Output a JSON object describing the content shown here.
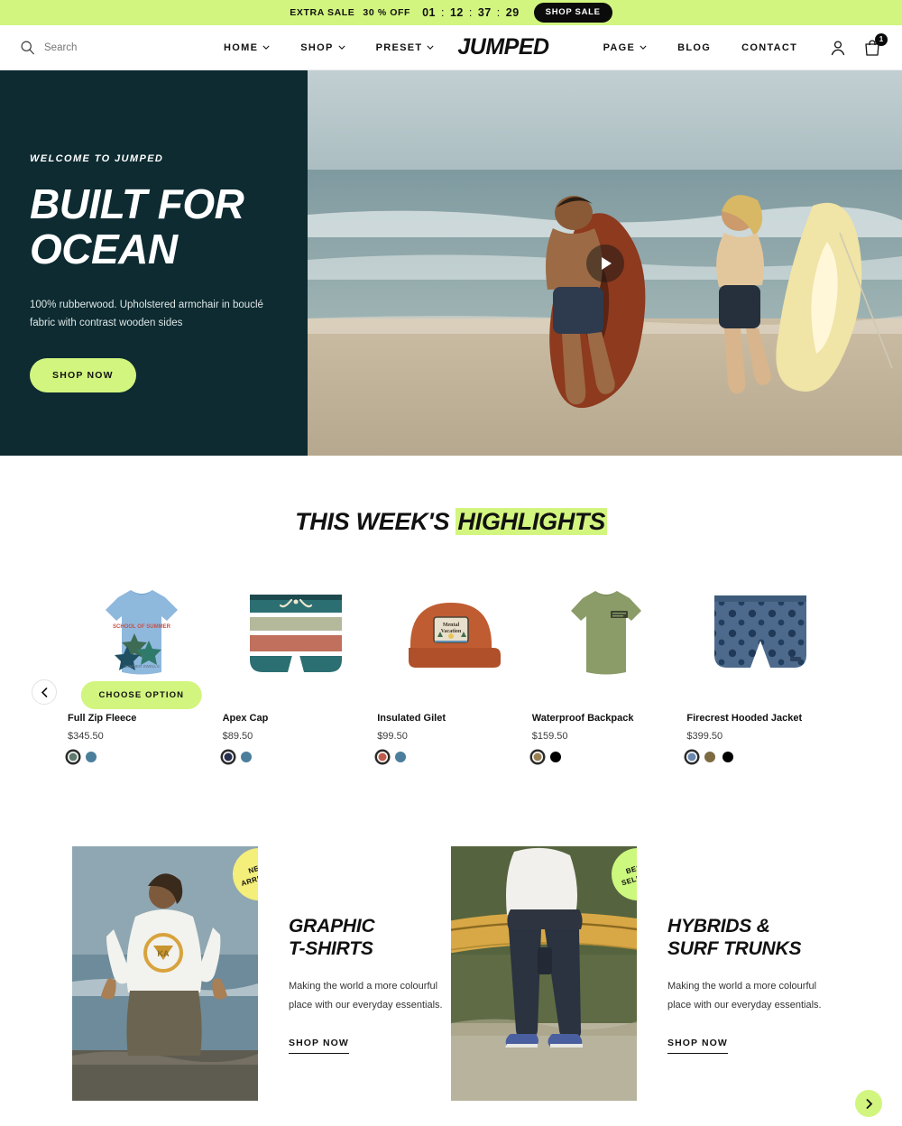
{
  "announcement": {
    "label": "EXTRA SALE",
    "discount": "30 % OFF",
    "countdown": {
      "days": "01",
      "hours": "12",
      "minutes": "37",
      "seconds": "29",
      "separator": ":"
    },
    "cta": "SHOP SALE",
    "bg_color": "#d2f57f"
  },
  "header": {
    "search_placeholder": "Search",
    "search_value": "",
    "logo": "JUMPED",
    "nav_left": [
      {
        "label": "HOME",
        "has_dropdown": true
      },
      {
        "label": "SHOP",
        "has_dropdown": true
      },
      {
        "label": "PRESET",
        "has_dropdown": true
      }
    ],
    "nav_right": [
      {
        "label": "PAGE",
        "has_dropdown": true
      },
      {
        "label": "BLOG",
        "has_dropdown": false
      },
      {
        "label": "CONTACT",
        "has_dropdown": false
      }
    ],
    "account_icon": "user-icon",
    "cart_icon": "cart-icon",
    "cart_count": "1"
  },
  "hero": {
    "eyebrow": "WELCOME TO JUMPED",
    "title_line1": "BUILT FOR",
    "title_line2": "OCEAN",
    "description": "100% rubberwood. Upholstered armchair in bouclé fabric with contrast wooden sides",
    "cta": "SHOP NOW",
    "bg_color": "#0d2b31",
    "accent_color": "#d2f57f",
    "media": "beach-surfers-video",
    "play_icon": "play-icon"
  },
  "highlights": {
    "title_plain": "THIS WEEK'S ",
    "title_highlight": "HIGHLIGHTS",
    "prev_label": "chevron-left-icon",
    "next_label": "chevron-right-icon",
    "hover_cta": "CHOOSE OPTION",
    "products": [
      {
        "name": "Full Zip Fleece",
        "price": "$345.50",
        "image": "light-blue-graphic-tshirt",
        "hovered": true,
        "swatches": [
          {
            "color": "#5f7b70",
            "selected": true
          },
          {
            "color": "#4a7e9b",
            "selected": false
          }
        ]
      },
      {
        "name": "Apex Cap",
        "price": "$89.50",
        "image": "striped-board-shorts",
        "hovered": false,
        "swatches": [
          {
            "color": "#28304f",
            "selected": true
          },
          {
            "color": "#4a7e9b",
            "selected": false
          }
        ]
      },
      {
        "name": "Insulated Gilet",
        "price": "$99.50",
        "image": "rust-mental-vacation-cap",
        "hovered": false,
        "swatches": [
          {
            "color": "#c05c4b",
            "selected": true
          },
          {
            "color": "#4a7e9b",
            "selected": false
          }
        ]
      },
      {
        "name": "Waterproof Backpack",
        "price": "$159.50",
        "image": "olive-green-tshirt",
        "hovered": false,
        "swatches": [
          {
            "color": "#9a8155",
            "selected": true
          },
          {
            "color": "#000000",
            "selected": false
          }
        ]
      },
      {
        "name": "Firecrest Hooded Jacket",
        "price": "$399.50",
        "image": "navy-floral-shorts",
        "hovered": false,
        "swatches": [
          {
            "color": "#6b88ae",
            "selected": true
          },
          {
            "color": "#7d6a40",
            "selected": false
          },
          {
            "color": "#000000",
            "selected": false
          }
        ]
      }
    ]
  },
  "promos": [
    {
      "badge_line1": "NEW",
      "badge_line2": "ARRIVALS",
      "badge_color": "#f4ee7a",
      "title_line1": "GRAPHIC",
      "title_line2": "T-SHIRTS",
      "description": "Making the world a more colourful place with our everyday essentials.",
      "link": "SHOP NOW",
      "image": "surfer-white-tshirt-ocean"
    },
    {
      "badge_line1": "BEST",
      "badge_line2": "SELLERS",
      "badge_color": "#ccf87e",
      "title_line1": "HYBRIDS &",
      "title_line2": "SURF TRUNKS",
      "description": "Making the world a more colourful place with our everyday essentials.",
      "link": "SHOP NOW",
      "image": "person-carrying-surfboard"
    }
  ]
}
